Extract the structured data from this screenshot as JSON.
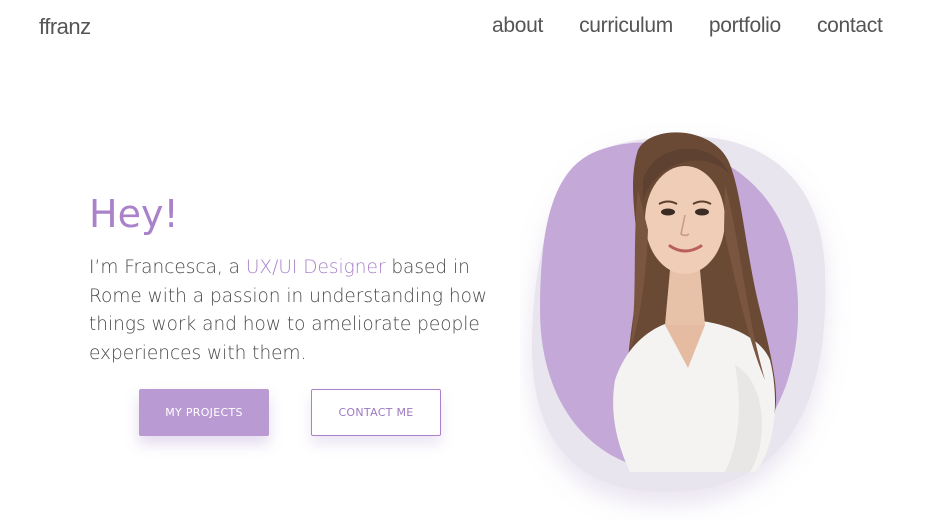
{
  "header": {
    "logo": "ffranz",
    "nav": [
      {
        "label": "about"
      },
      {
        "label": "curriculum"
      },
      {
        "label": "portfolio"
      },
      {
        "label": "contact"
      }
    ]
  },
  "hero": {
    "title": "Hey!",
    "intro_prefix": "I’m Francesca, a ",
    "intro_accent": "UX/UI Designer",
    "intro_suffix": " based in Rome with a passion in understanding how things work and how to ameliorate people experiences with them.",
    "primary_button": "MY PROJECTS",
    "secondary_button": "CONTACT ME"
  },
  "colors": {
    "accent": "#a982c9",
    "blob_back": "#e9e5ef",
    "blob_front": "#c3a8d8",
    "button_fill": "#b99ad3"
  }
}
